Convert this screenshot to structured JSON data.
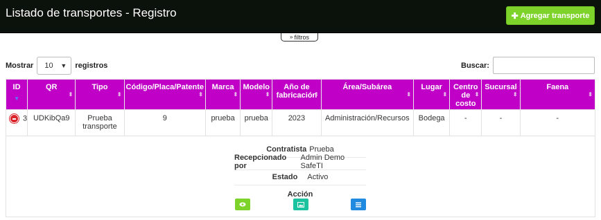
{
  "header": {
    "title": "Listado de transportes - Registro",
    "add_button_label": "Agregar transporte"
  },
  "filters": {
    "toggle_label": "filtros"
  },
  "length": {
    "prefix": "Mostrar",
    "value": "10",
    "suffix": "registros"
  },
  "search": {
    "label": "Buscar:",
    "value": ""
  },
  "table": {
    "headers": {
      "id": "ID",
      "qr": "QR",
      "tipo": "Tipo",
      "codigo": "Código/Placa/Patente",
      "marca": "Marca",
      "modelo": "Modelo",
      "anio": "Año de fabricación",
      "area": "Área/Subárea",
      "lugar": "Lugar",
      "centro": "Centro de costo",
      "sucursal": "Sucursal",
      "faena": "Faena"
    },
    "row": {
      "id": "3",
      "qr": "UDKibQa9",
      "tipo": "Prueba transporte",
      "codigo": "9",
      "marca": "prueba",
      "modelo": "prueba",
      "anio": "2023",
      "area": "Administración/Recursos",
      "lugar": "Bodega",
      "centro": "-",
      "sucursal": "-",
      "faena": "-"
    }
  },
  "detail": {
    "contratista_label": "Contratista",
    "contratista_value": "Prueba",
    "recepcionado_label": "Recepcionado por",
    "recepcionado_value": "Admin Demo SafeTI",
    "estado_label": "Estado",
    "estado_value": "Activo",
    "accion_label": "Acción"
  },
  "colors": {
    "header_bg": "#0b110b",
    "accent": "#c000c7",
    "add_button": "#7ed32a",
    "view_button": "#7ed32a",
    "image_button": "#1cc3a0",
    "list_button": "#1f8ae0",
    "collapse_icon": "#d9242b"
  },
  "icons": {
    "add": "plus-icon",
    "filters": "chevron-down-icon",
    "view": "eye-icon",
    "image": "image-icon",
    "list": "list-icon",
    "collapse": "minus-circle-icon"
  }
}
